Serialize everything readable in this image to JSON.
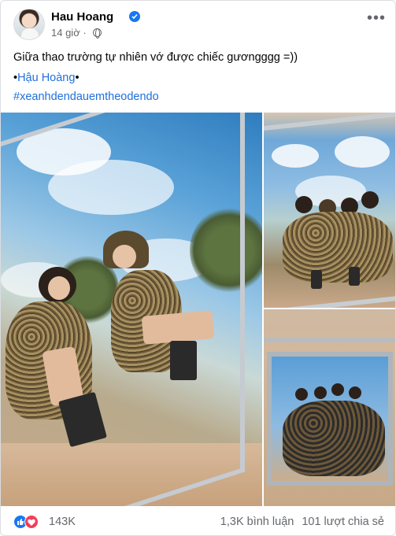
{
  "post": {
    "author": "Hau Hoang",
    "time": "14 giờ",
    "caption_line1": "Giữa thao trường tự nhiên vớ được chiếc gươngggg =))",
    "caption_line2_prefix": "•",
    "caption_line2_link": "Hậu Hoàng",
    "caption_line2_suffix": "•",
    "hashtag": "#xeanhdendauemtheodendo",
    "reactions_count": "143K",
    "comments": "1,3K bình luận",
    "shares": "101 lượt chia sẻ"
  },
  "icons": {
    "verified": "verified-badge-icon",
    "privacy": "globe-icon",
    "more": "more-options-icon",
    "like": "like-reaction-icon",
    "love": "love-reaction-icon"
  },
  "colors": {
    "accent": "#1877f2",
    "link": "#216fdb",
    "secondary_text": "#65676b",
    "love": "#f33e58"
  }
}
